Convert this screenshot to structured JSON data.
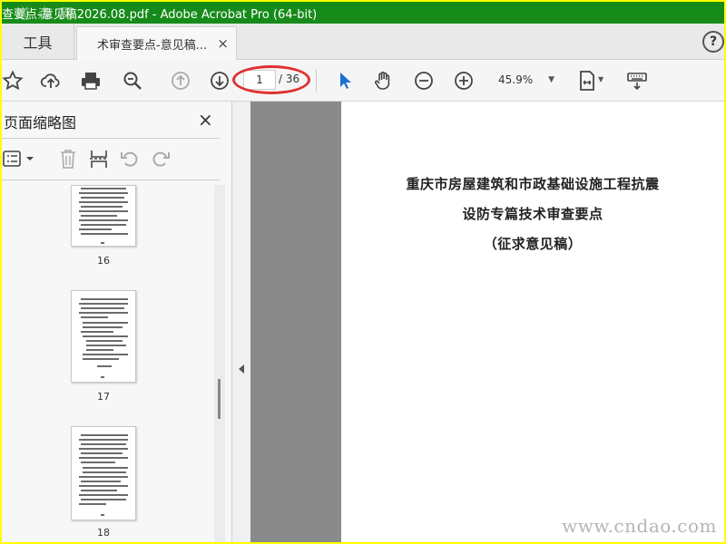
{
  "window": {
    "title": "查要点-意见稿2026.08.pdf - Adobe Acrobat Pro (64-bit)",
    "watermark_overlay": "道 森 网"
  },
  "tabs": {
    "tools_label": "工具",
    "document_tab_label": "术审查要点-意见稿...",
    "close_glyph": "×",
    "help_glyph": "?"
  },
  "toolbar": {
    "icons": [
      "star-icon",
      "cloud-upload-icon",
      "print-icon",
      "zoom-search-icon",
      "page-up-icon",
      "page-down-icon",
      "select-arrow-icon",
      "hand-icon",
      "zoom-out-icon",
      "zoom-in-icon",
      "fit-page-icon",
      "keyboard-icon"
    ],
    "current_page": "1",
    "total_pages": "/ 36",
    "zoom_value": "45.9%",
    "annotation_color": "#e03030"
  },
  "left_panel": {
    "title": "页面缩略图",
    "close_glyph": "×",
    "thumbnails": [
      {
        "page_label": "16"
      },
      {
        "page_label": "17"
      },
      {
        "page_label": "18"
      }
    ]
  },
  "document": {
    "heading_line1": "重庆市房屋建筑和市政基础设施工程抗震",
    "heading_line2": "设防专篇技术审查要点",
    "heading_line3": "（征求意见稿）"
  },
  "site_watermark": "www.cndao.com",
  "colors": {
    "titlebar": "#178b1a",
    "frame_border": "#ffff00",
    "select_tool": "#1a6fd1",
    "doc_background": "#8a8a8a"
  }
}
